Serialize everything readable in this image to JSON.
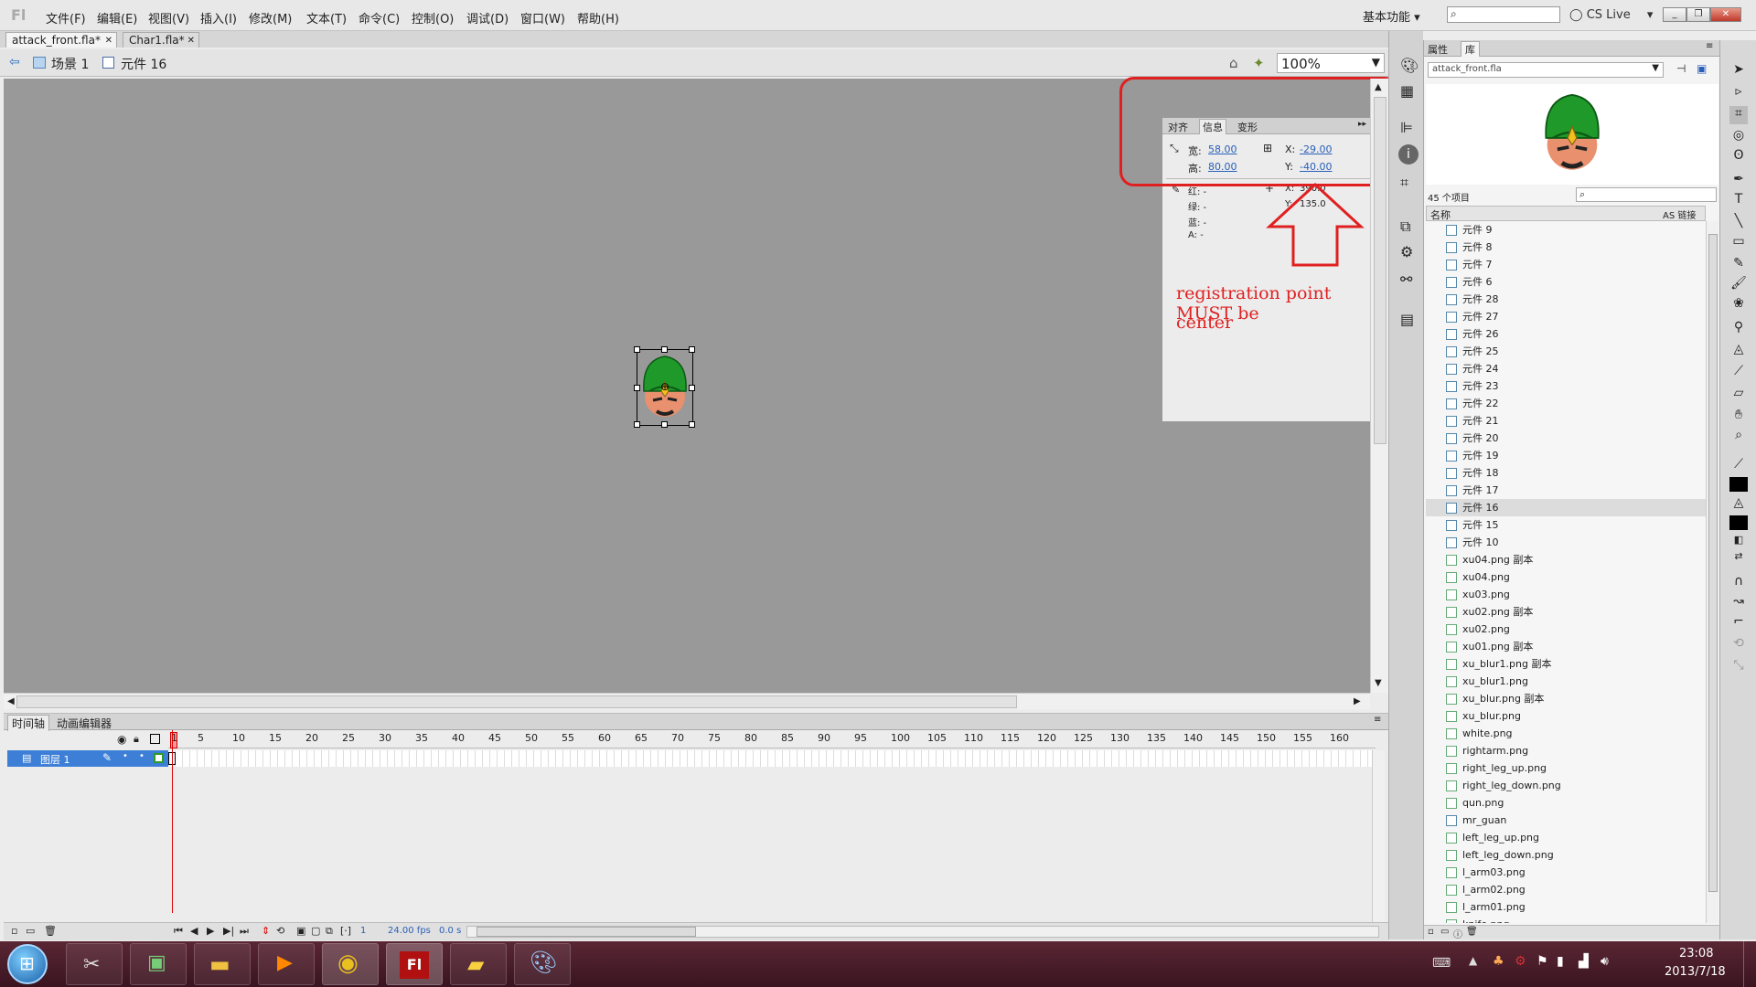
{
  "menubar": {
    "logo": "Fl",
    "menus": [
      "文件(F)",
      "编辑(E)",
      "视图(V)",
      "插入(I)",
      "修改(M)",
      "文本(T)",
      "命令(C)",
      "控制(O)",
      "调试(D)",
      "窗口(W)",
      "帮助(H)"
    ],
    "workspace": "基本功能",
    "cs_live": "CS Live"
  },
  "tabs": [
    {
      "label": "attack_front.fla*",
      "active": true
    },
    {
      "label": "Char1.fla*",
      "active": false
    }
  ],
  "editbar": {
    "scene": "场景 1",
    "symbol": "元件 16",
    "zoom": "100%"
  },
  "info_panel": {
    "tabs": [
      "对齐",
      "信息",
      "变形"
    ],
    "active_tab": "信息",
    "width_label": "宽:",
    "width_value": "58.00",
    "height_label": "高:",
    "height_value": "80.00",
    "x_label": "X:",
    "x_value": "-29.00",
    "y_label": "Y:",
    "y_value": "-40.00",
    "red_label": "红: -",
    "green_label": "绿: -",
    "blue_label": "蓝: -",
    "alpha_label": "A: -",
    "cursor_x_label": "X:",
    "cursor_x_value": "390.0",
    "cursor_y_label": "Y:",
    "cursor_y_value": "135.0"
  },
  "annotation": {
    "text": "registration point MUST be center",
    "line1": "registration point MUST be",
    "line2": "center",
    "color": "#e02020"
  },
  "timeline": {
    "tabs": [
      "时间轴",
      "动画编辑器"
    ],
    "layer_name": "图层 1",
    "frame_numbers": [
      "1",
      "5",
      "10",
      "15",
      "20",
      "25",
      "30",
      "35",
      "40",
      "45",
      "50",
      "55",
      "60",
      "65",
      "70",
      "75",
      "80",
      "85",
      "90",
      "95",
      "100",
      "105",
      "110",
      "115",
      "120",
      "125",
      "130",
      "135",
      "140",
      "145",
      "150",
      "155",
      "160"
    ],
    "current_frame": "1",
    "fps": "24.00 fps",
    "time": "0.0 s"
  },
  "library": {
    "tabs": [
      "属性",
      "库"
    ],
    "active_tab": "库",
    "document": "attack_front.fla",
    "item_count": "45 个项目",
    "col_name": "名称",
    "col_linkage": "AS 链接",
    "items": [
      {
        "name": "元件 9",
        "type": "symbol"
      },
      {
        "name": "元件 8",
        "type": "symbol"
      },
      {
        "name": "元件 7",
        "type": "symbol"
      },
      {
        "name": "元件 6",
        "type": "symbol"
      },
      {
        "name": "元件 28",
        "type": "symbol"
      },
      {
        "name": "元件 27",
        "type": "symbol"
      },
      {
        "name": "元件 26",
        "type": "symbol"
      },
      {
        "name": "元件 25",
        "type": "symbol"
      },
      {
        "name": "元件 24",
        "type": "symbol"
      },
      {
        "name": "元件 23",
        "type": "symbol"
      },
      {
        "name": "元件 22",
        "type": "symbol"
      },
      {
        "name": "元件 21",
        "type": "symbol"
      },
      {
        "name": "元件 20",
        "type": "symbol"
      },
      {
        "name": "元件 19",
        "type": "symbol"
      },
      {
        "name": "元件 18",
        "type": "symbol"
      },
      {
        "name": "元件 17",
        "type": "symbol"
      },
      {
        "name": "元件 16",
        "type": "symbol",
        "selected": true
      },
      {
        "name": "元件 15",
        "type": "symbol"
      },
      {
        "name": "元件 10",
        "type": "symbol"
      },
      {
        "name": "xu04.png 副本",
        "type": "bitmap"
      },
      {
        "name": "xu04.png",
        "type": "bitmap"
      },
      {
        "name": "xu03.png",
        "type": "bitmap"
      },
      {
        "name": "xu02.png 副本",
        "type": "bitmap"
      },
      {
        "name": "xu02.png",
        "type": "bitmap"
      },
      {
        "name": "xu01.png 副本",
        "type": "bitmap"
      },
      {
        "name": "xu_blur1.png 副本",
        "type": "bitmap"
      },
      {
        "name": "xu_blur1.png",
        "type": "bitmap"
      },
      {
        "name": "xu_blur.png 副本",
        "type": "bitmap"
      },
      {
        "name": "xu_blur.png",
        "type": "bitmap"
      },
      {
        "name": "white.png",
        "type": "bitmap"
      },
      {
        "name": "rightarm.png",
        "type": "bitmap"
      },
      {
        "name": "right_leg_up.png",
        "type": "bitmap"
      },
      {
        "name": "right_leg_down.png",
        "type": "bitmap"
      },
      {
        "name": "qun.png",
        "type": "bitmap"
      },
      {
        "name": "mr_guan",
        "type": "symbol"
      },
      {
        "name": "left_leg_up.png",
        "type": "bitmap"
      },
      {
        "name": "left_leg_down.png",
        "type": "bitmap"
      },
      {
        "name": "l_arm03.png",
        "type": "bitmap"
      },
      {
        "name": "l_arm02.png",
        "type": "bitmap"
      },
      {
        "name": "l_arm01.png",
        "type": "bitmap"
      },
      {
        "name": "knife.png",
        "type": "bitmap"
      }
    ]
  },
  "taskbar": {
    "time": "23:08",
    "date": "2013/7/18"
  }
}
